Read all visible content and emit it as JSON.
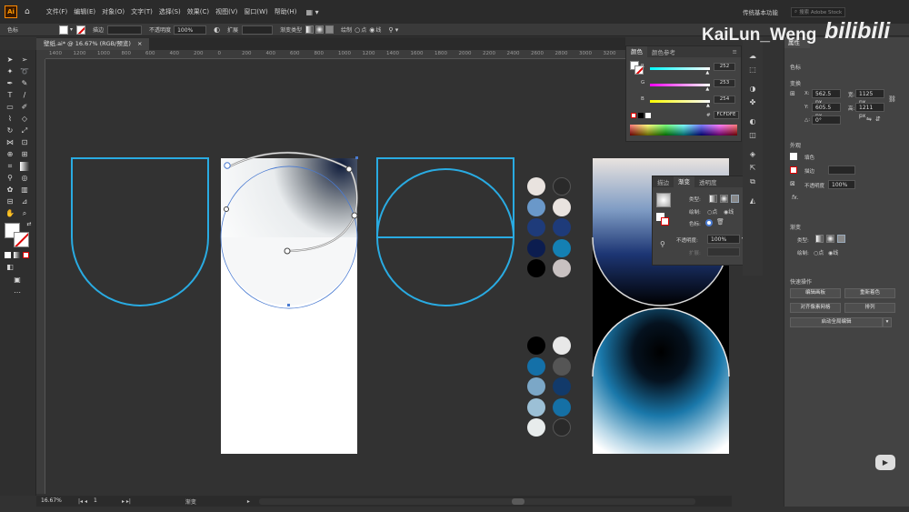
{
  "app": {
    "logo": "Ai",
    "workspace": "传统基本功能",
    "search_placeholder": "搜索 Adobe Stock"
  },
  "menu": [
    "文件(F)",
    "编辑(E)",
    "对象(O)",
    "文字(T)",
    "选择(S)",
    "效果(C)",
    "视图(V)",
    "窗口(W)",
    "帮助(H)"
  ],
  "control_bar": {
    "mode_label": "色标",
    "stroke_label": "描边",
    "opacity_label": "不透明度",
    "opacity_value": "100%",
    "expand_label": "扩展",
    "gradient_type_label": "渐变类型",
    "draw_label": "绘制",
    "point_label": "点",
    "line_label": "线"
  },
  "document_tab": {
    "title": "壁纸.ai* @ 16.67% (RGB/预览)"
  },
  "ruler": [
    "1400",
    "1200",
    "1000",
    "800",
    "600",
    "400",
    "200",
    "0",
    "200",
    "400",
    "600",
    "800",
    "1000",
    "1200",
    "1400",
    "1600",
    "1800",
    "2000",
    "2200",
    "2400",
    "2600",
    "2800",
    "3000",
    "3200"
  ],
  "status": {
    "zoom": "16.67%",
    "artboard": "1",
    "tool": "渐变"
  },
  "color_panel": {
    "tabs": [
      "颜色",
      "颜色参考"
    ],
    "r_label": "R",
    "g_label": "G",
    "b_label": "B",
    "r": "252",
    "g": "253",
    "b": "254",
    "hex_label": "#",
    "hex": "FCFDFE",
    "r_level": 0.99,
    "g_level": 0.99,
    "b_level": 1.0
  },
  "gradient_panel": {
    "tabs": [
      "描边",
      "渐变",
      "透明度"
    ],
    "type_label": "类型:",
    "draw_label": "绘制:",
    "point_label": "点",
    "line_label": "线",
    "stop_label": "色标:",
    "opacity_label": "不透明度:",
    "opacity": "100%",
    "location_label": "扩展:"
  },
  "properties": {
    "tabs": [
      "属性"
    ],
    "selection": "色标",
    "transform_title": "变换",
    "x_label": "X:",
    "x": "562.5 px",
    "y_label": "Y:",
    "y": "605.5 px",
    "w_label": "宽:",
    "w": "1125 px",
    "h_label": "高:",
    "h": "1211 px",
    "angle_label": "△:",
    "angle": "0°",
    "appearance_title": "外观",
    "fill_label": "填色",
    "stroke_label": "描边",
    "opacity_label": "不透明度",
    "opacity": "100%",
    "fx_label": "fx.",
    "gradient_title": "渐变",
    "type_label": "类型:",
    "draw_label": "绘制:",
    "point_label": "点",
    "line_label": "线",
    "quick_actions_title": "快速操作",
    "buttons": [
      "编辑画板",
      "重新着色",
      "对齐像素网格",
      "排列",
      "启动全局编辑"
    ]
  },
  "swatches": {
    "group_top": [
      [
        "#e9e3df",
        "#2a2a2a"
      ],
      [
        "#6a98c9",
        "#e9e3df"
      ],
      [
        "#1e3b7a",
        "#1e3b7a"
      ],
      [
        "#0c1d4f",
        "#1480b3"
      ],
      [
        "#000000",
        "#c8c1c1"
      ]
    ],
    "group_bottom": [
      [
        "#000000",
        "#e8e8e8"
      ],
      [
        "#1470a8",
        "#555555"
      ],
      [
        "#7ba7c7",
        "#123a6a"
      ],
      [
        "#9cc0d6",
        "#1570a5"
      ],
      [
        "#e8ecec",
        "#2a2a2a"
      ]
    ]
  },
  "colors": {
    "accent_cyan": "#29abe2",
    "selection_blue": "#4a7bd1",
    "panel_bg": "#424242",
    "canvas_bg": "#323232"
  },
  "watermark": {
    "author": "KaiLun_Weng",
    "site": "bilibili"
  }
}
